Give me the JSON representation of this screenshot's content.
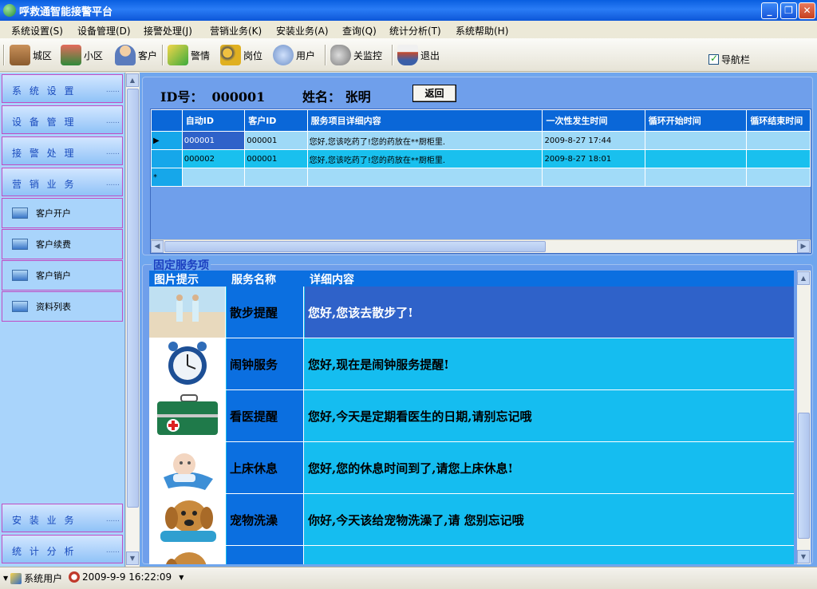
{
  "window": {
    "title": "呼救通智能接警平台",
    "buttons": {
      "minimize": "_",
      "maximize": "❐",
      "close": "✕"
    }
  },
  "menu": [
    "系统设置(S)",
    "设备管理(D)",
    "接警处理(J)",
    "营销业务(K)",
    "安装业务(A)",
    "查询(Q)",
    "统计分析(T)",
    "系统帮助(H)"
  ],
  "toolbar": {
    "items": [
      {
        "label": "城区",
        "icon": "city-buildings-icon",
        "color": "#8a5b2e"
      },
      {
        "label": "小区",
        "icon": "houses-icon",
        "color": "#c0392b"
      },
      {
        "label": "客户",
        "icon": "person-icon",
        "color": "#e2b07a"
      },
      {
        "label": "警情",
        "icon": "alarm-pencil-icon",
        "color": "#3cab3c"
      },
      {
        "label": "岗位",
        "icon": "users-group-icon",
        "color": "#e0b020"
      },
      {
        "label": "用户",
        "icon": "network-globe-icon",
        "color": "#6d8fc8"
      },
      {
        "label": "关监控",
        "icon": "speaker-off-icon",
        "color": "#777777"
      },
      {
        "label": "退出",
        "icon": "java-cup-exit-icon",
        "color": "#c84a2a"
      }
    ],
    "nav_toggle": "导航栏"
  },
  "sidebar": {
    "headers_top": [
      "系 统 设 置",
      "设 备 管 理",
      "接 警 处 理",
      "营 销 业 务"
    ],
    "items": [
      "客户开户",
      "客户续费",
      "客户销户",
      "资料列表"
    ],
    "headers_bottom": [
      "安 装 业 务",
      "统 计 分 析"
    ],
    "dots": "......"
  },
  "customer": {
    "id_label": "ID号：",
    "id_value": "000001",
    "name_label": "姓名：",
    "name_value": "张明",
    "back_button": "返回"
  },
  "grid": {
    "columns": [
      "自动ID",
      "客户ID",
      "服务项目详细内容",
      "一次性发生时间",
      "循环开始时间",
      "循环结束时间"
    ],
    "rows": [
      {
        "marker": "▶",
        "auto_id": "000001",
        "client_id": "000001",
        "content": "您好,您该吃药了!您的药放在**厨柜里.",
        "time": "2009-8-27 17:44",
        "loop_start": "",
        "loop_end": ""
      },
      {
        "marker": "",
        "auto_id": "000002",
        "client_id": "000001",
        "content": "您好,您该吃药了!您的药放在**厨柜里.",
        "time": "2009-8-27 18:01",
        "loop_start": "",
        "loop_end": ""
      }
    ],
    "new_row_marker": "*"
  },
  "services": {
    "group_label": "固定服务项",
    "columns": [
      "图片提示",
      "服务名称",
      "详细内容"
    ],
    "rows": [
      {
        "name": "散步提醒",
        "content": "您好,您该去散步了!",
        "image": "walking-couple-photo"
      },
      {
        "name": "闹钟服务",
        "content": "您好,现在是闹钟服务提醒!",
        "image": "alarm-clock-photo"
      },
      {
        "name": "看医提醒",
        "content": "您好,今天是定期看医生的日期,请别忘记哦",
        "image": "medical-kit-photo"
      },
      {
        "name": "上床休息",
        "content": "您好,您的休息时间到了,请您上床休息!",
        "image": "sleeping-baby-photo"
      },
      {
        "name": "宠物洗澡",
        "content": "你好,今天该给宠物洗澡了,请   您别忘记哦",
        "image": "dog-bath-photo"
      }
    ]
  },
  "status": {
    "user": "系统用户",
    "datetime": "2009-9-9 16:22:09"
  }
}
